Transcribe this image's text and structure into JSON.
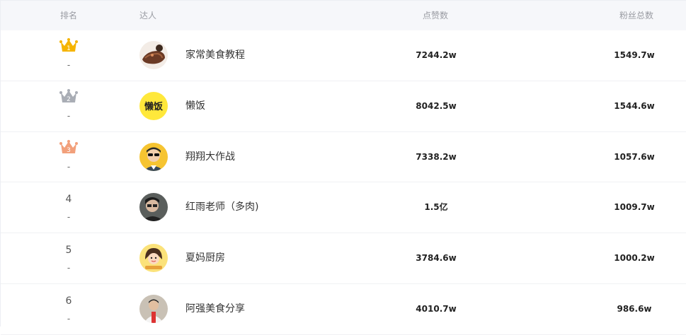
{
  "header": {
    "rank_label": "排名",
    "name_label": "达人",
    "likes_label": "点赞数",
    "fans_label": "粉丝总数"
  },
  "rows": [
    {
      "rank": "1",
      "dash": "-",
      "name": "家常美食教程",
      "likes": "7244.2w",
      "fans": "1549.7w"
    },
    {
      "rank": "2",
      "dash": "-",
      "name": "懒饭",
      "likes": "8042.5w",
      "fans": "1544.6w"
    },
    {
      "rank": "3",
      "dash": "-",
      "name": "翔翔大作战",
      "likes": "7338.2w",
      "fans": "1057.6w"
    },
    {
      "rank": "4",
      "dash": "-",
      "name": "红雨老师（多肉)",
      "likes": "1.5亿",
      "fans": "1009.7w"
    },
    {
      "rank": "5",
      "dash": "-",
      "name": "夏妈厨房",
      "likes": "3784.6w",
      "fans": "1000.2w"
    },
    {
      "rank": "6",
      "dash": "-",
      "name": "阿强美食分享",
      "likes": "4010.7w",
      "fans": "986.6w"
    }
  ],
  "avatars": {
    "lanfan_text": "懒饭"
  },
  "colors": {
    "gold": "#f5b400",
    "silver": "#a9adb5",
    "bronze": "#f2a07b",
    "header_bg": "#f6f7fa"
  }
}
